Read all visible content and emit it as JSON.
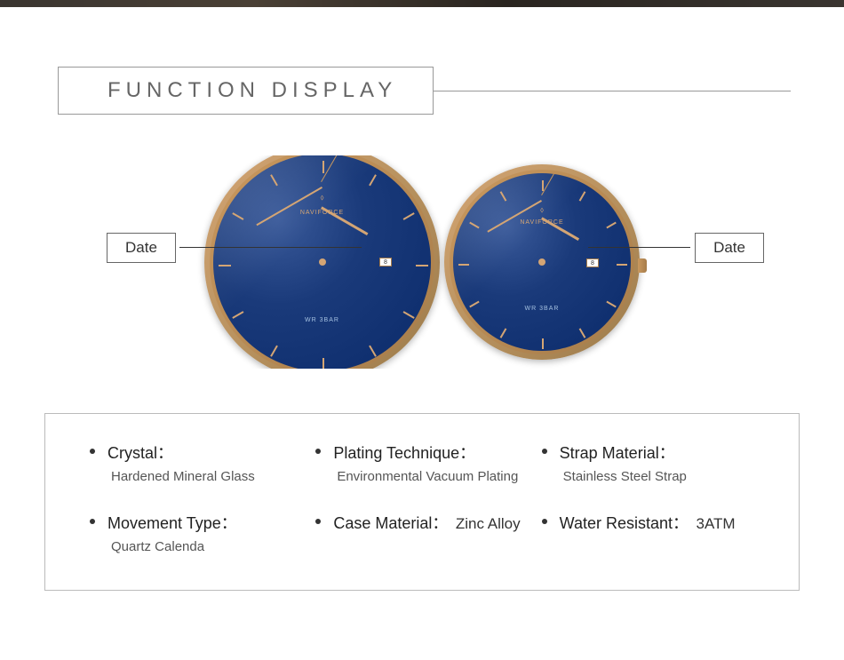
{
  "header": {
    "title": "FUNCTION  DISPLAY"
  },
  "watches": {
    "brand": "NAVIFORCE",
    "waterResistText": "WR 3BAR",
    "dateValue": "8"
  },
  "callouts": {
    "left": "Date",
    "right": "Date"
  },
  "specs": {
    "row1": [
      {
        "label": "Crystal：",
        "value": "Hardened Mineral Glass",
        "inline": false
      },
      {
        "label": "Plating Technique：",
        "value": "Environmental Vacuum Plating",
        "inline": false
      },
      {
        "label": "Strap Material：",
        "value": "Stainless Steel Strap",
        "inline": false
      }
    ],
    "row2": [
      {
        "label": "Movement Type：",
        "value": "Quartz Calenda",
        "inline": false
      },
      {
        "label": "Case Material：",
        "value": "Zinc Alloy",
        "inline": true
      },
      {
        "label": "Water Resistant：",
        "value": "3ATM",
        "inline": true
      }
    ]
  }
}
